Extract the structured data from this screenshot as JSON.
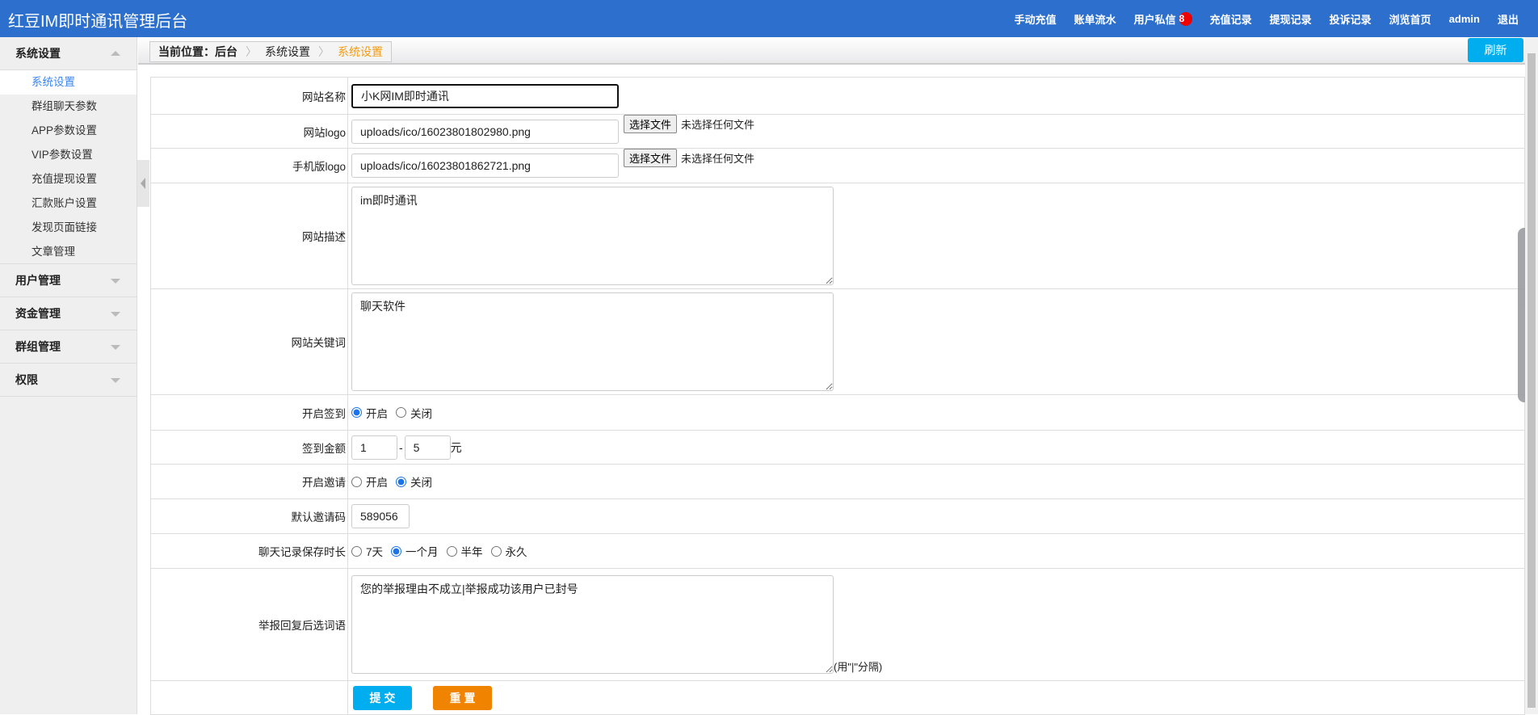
{
  "header": {
    "title": "红豆IM即时通讯管理后台",
    "nav": [
      {
        "label": "手动充值"
      },
      {
        "label": "账单流水"
      },
      {
        "label": "用户私信",
        "badge": "8"
      },
      {
        "label": "充值记录"
      },
      {
        "label": "提现记录"
      },
      {
        "label": "投诉记录"
      },
      {
        "label": "浏览首页"
      },
      {
        "label": "admin"
      },
      {
        "label": "退出"
      }
    ]
  },
  "sidebar": {
    "group1": "系统设置",
    "items": [
      "系统设置",
      "群组聊天参数",
      "APP参数设置",
      "VIP参数设置",
      "充值提现设置",
      "汇款账户设置",
      "发现页面链接",
      "文章管理"
    ],
    "groups": [
      "用户管理",
      "资金管理",
      "群组管理",
      "权限"
    ]
  },
  "breadcrumb": {
    "prefix": "当前位置：后台",
    "level1": "系统设置",
    "current": "系统设置"
  },
  "refresh_label": "刷新",
  "form": {
    "site_name_label": "网站名称",
    "site_name": "小K网IM即时通讯",
    "logo_label": "网站logo",
    "logo": "uploads/ico/16023801802980.png",
    "mlogo_label": "手机版logo",
    "mlogo": "uploads/ico/16023801862721.png",
    "file_button": "选择文件",
    "file_none": "未选择任何文件",
    "desc_label": "网站描述",
    "desc": "im即时通讯",
    "keywords_label": "网站关键词",
    "keywords": "聊天软件",
    "signin_label": "开启签到",
    "on": "开启",
    "off": "关闭",
    "amount_label": "签到金额",
    "amount_min": "1",
    "amount_dash": "-",
    "amount_max": "5",
    "amount_unit": "元",
    "invite_label": "开启邀请",
    "invite_code_label": "默认邀请码",
    "invite_code": "589056",
    "retention_label": "聊天记录保存时长",
    "retention_options": [
      "7天",
      "一个月",
      "半年",
      "永久"
    ],
    "report_label": "举报回复后选词语",
    "report": "您的举报理由不成立|举报成功该用户已封号",
    "report_hint": "(用\"|\"分隔)",
    "submit": "提 交",
    "reset": "重 置"
  },
  "colors": {
    "header": "#2d6fcd",
    "submit": "#00aeef",
    "reset": "#f08300",
    "active": "#3a86f5"
  }
}
